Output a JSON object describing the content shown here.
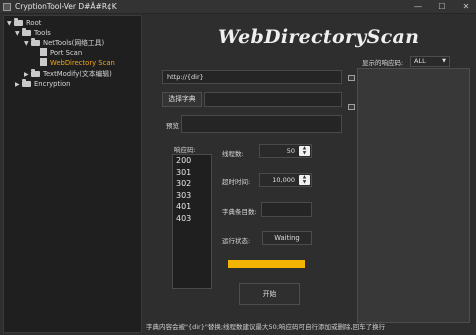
{
  "window": {
    "title": "CryptionTool-Ver D#Ä#R¢K",
    "minimize_glyph": "—",
    "maximize_glyph": "☐",
    "close_glyph": "✕"
  },
  "tree": {
    "items": [
      {
        "label": "Root",
        "arrow": "▼",
        "icon": "folder-icon"
      },
      {
        "label": "Tools",
        "arrow": "▼",
        "icon": "folder-icon"
      },
      {
        "label": "NetTools(网络工具)",
        "arrow": "▼",
        "icon": "folder-icon"
      },
      {
        "label": "Port Scan",
        "arrow": "",
        "icon": "file-icon"
      },
      {
        "label": "WebDirectory Scan",
        "arrow": "",
        "icon": "file-icon",
        "selected": true
      },
      {
        "label": "TextModify(文本编辑)",
        "arrow": "▶",
        "icon": "folder-icon"
      },
      {
        "label": "Encryption",
        "arrow": "▶",
        "icon": "folder-icon"
      }
    ]
  },
  "main": {
    "title": "WebDirectoryScan",
    "url_value": "http://{dir}",
    "dict_button": "选择字典",
    "dict_path": "",
    "preview_label": "预览",
    "preview_value": "",
    "codes_label": "响应码:",
    "codes": [
      "200",
      "301",
      "302",
      "303",
      "401",
      "403"
    ],
    "threads_label": "线程数:",
    "threads_value": "50",
    "timeout_label": "超时时间:",
    "timeout_value": "10,000",
    "dict_count_label": "字典条目数:",
    "dict_count_value": "",
    "status_label": "运行状态:",
    "status_value": "Waiting",
    "progress": 1.0,
    "start_button": "开始"
  },
  "right": {
    "filter_label": "显示的响应码:",
    "filter_value": "ALL"
  },
  "footer": {
    "note": "字典内容会被\"{dir}\"替换;线程数建议最大50;响应码可自行添加或删除,回车了换行"
  },
  "colors": {
    "accent": "#f2a516",
    "progress": "#f2b400",
    "background": "#2e2e2e"
  }
}
